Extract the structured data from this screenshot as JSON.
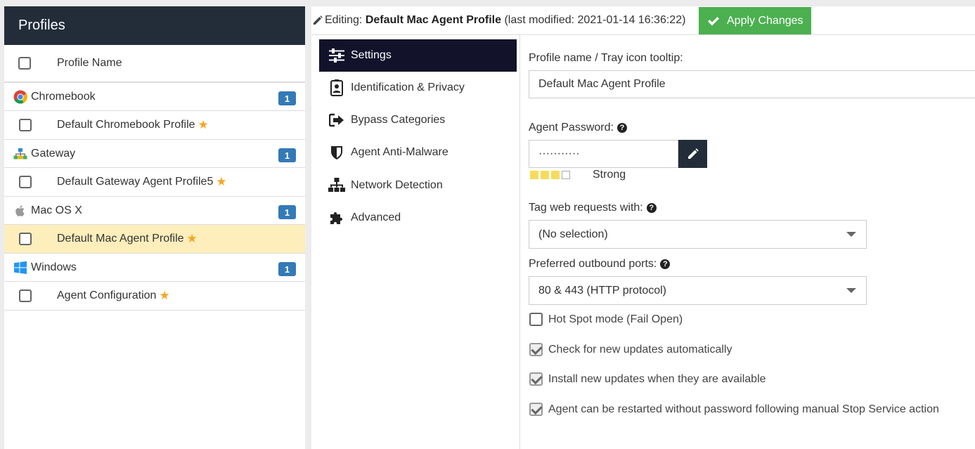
{
  "left": {
    "title": "Profiles",
    "column_header": "Profile Name",
    "groups": [
      {
        "name": "Chromebook",
        "count": "1",
        "icon": "chrome-icon",
        "profiles": [
          {
            "name": "Default Chromebook Profile",
            "default": true,
            "selected": false
          }
        ]
      },
      {
        "name": "Gateway",
        "count": "1",
        "icon": "network-icon",
        "profiles": [
          {
            "name": "Default Gateway Agent Profile5",
            "default": true,
            "selected": false
          }
        ]
      },
      {
        "name": "Mac OS X",
        "count": "1",
        "icon": "apple-icon",
        "profiles": [
          {
            "name": "Default Mac Agent Profile",
            "default": true,
            "selected": true
          }
        ]
      },
      {
        "name": "Windows",
        "count": "1",
        "icon": "windows-icon",
        "profiles": [
          {
            "name": "Agent Configuration",
            "default": true,
            "selected": false
          }
        ]
      }
    ]
  },
  "editbar": {
    "prefix": "Editing: ",
    "profile_name": "Default Mac Agent Profile",
    "suffix": " (last modified: 2021-01-14 16:36:22)",
    "apply_label": "Apply Changes"
  },
  "nav": {
    "items": [
      {
        "label": "Settings",
        "icon": "sliders-icon",
        "active": true
      },
      {
        "label": "Identification & Privacy",
        "icon": "id-badge-icon",
        "active": false
      },
      {
        "label": "Bypass Categories",
        "icon": "sign-out-icon",
        "active": false
      },
      {
        "label": "Agent Anti-Malware",
        "icon": "shield-icon",
        "active": false
      },
      {
        "label": "Network Detection",
        "icon": "sitemap-icon",
        "active": false
      },
      {
        "label": "Advanced",
        "icon": "puzzle-icon",
        "active": false
      }
    ]
  },
  "form": {
    "profile_name_label": "Profile name / Tray icon tooltip:",
    "profile_name_value": "Default Mac Agent Profile",
    "password_label": "Agent Password:",
    "password_value": "···········",
    "strength_label": "Strong",
    "strength_level": "3 of 4",
    "tag_label": "Tag web requests with:",
    "tag_value": "(No selection)",
    "ports_label": "Preferred outbound ports:",
    "ports_value": "80 & 443 (HTTP protocol)",
    "checks": [
      {
        "label": "Hot Spot mode (Fail Open)",
        "checked": false
      },
      {
        "label": "Check for new updates automatically",
        "checked": true
      },
      {
        "label": "Install new updates when they are available",
        "checked": true
      },
      {
        "label": "Agent can be restarted without password following manual Stop Service action",
        "checked": true
      }
    ]
  },
  "colors": {
    "header_dark": "#232d3a",
    "nav_active": "#12122b",
    "apply_green": "#4caf50",
    "badge_blue": "#337ab7",
    "selected_row": "#fdeebc",
    "star": "#f5a623"
  }
}
